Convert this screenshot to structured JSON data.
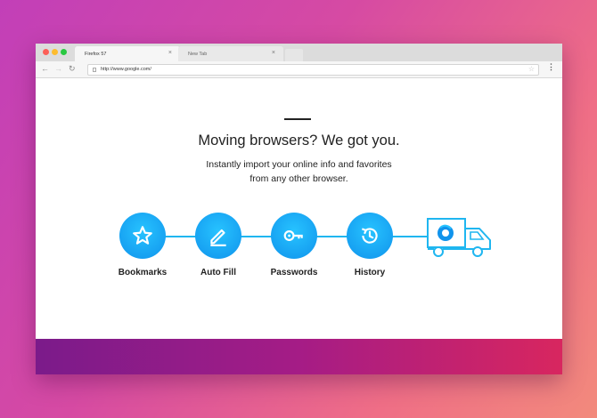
{
  "browser": {
    "tabs": [
      {
        "label": "Firefox 57",
        "active": true
      },
      {
        "label": "New Tab",
        "active": false
      }
    ],
    "close_glyph": "×",
    "url": "http://www.google.com/"
  },
  "page": {
    "heading": "Moving browsers? We got you.",
    "subtitle_line1": "Instantly import your online info and favorites",
    "subtitle_line2": "from any other browser.",
    "steps": [
      {
        "label": "Bookmarks",
        "icon": "star-icon"
      },
      {
        "label": "Auto Fill",
        "icon": "pencil-icon"
      },
      {
        "label": "Passwords",
        "icon": "key-icon"
      },
      {
        "label": "History",
        "icon": "history-icon"
      }
    ],
    "truck_icon": "moving-truck-icon"
  },
  "colors": {
    "accent_blue": "#1fb6f0",
    "band_start": "#7b1b8a",
    "band_end": "#d8265f"
  }
}
